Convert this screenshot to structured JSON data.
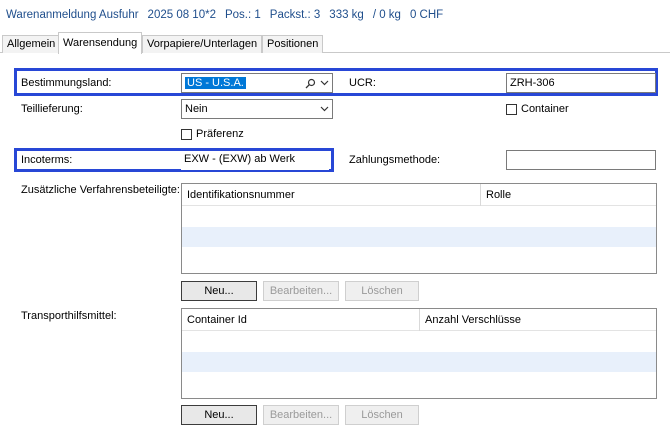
{
  "header": {
    "title": "Warenanmeldung Ausfuhr",
    "number": "2025 08 10*2",
    "pos": "Pos.: 1",
    "packst": "Packst.: 3",
    "weight": "333 kg",
    "weight2": "/ 0 kg",
    "value": "0 CHF"
  },
  "tabs": [
    {
      "label": "Allgemein"
    },
    {
      "label": "Warensendung"
    },
    {
      "label": "Vorpapiere/Unterlagen"
    },
    {
      "label": "Positionen"
    }
  ],
  "form": {
    "bestimmungsland_label": "Bestimmungsland:",
    "bestimmungsland_value": "US - U.S.A.",
    "ucr_label": "UCR:",
    "ucr_value": "ZRH-306",
    "teillieferung_label": "Teillieferung:",
    "teillieferung_value": "Nein",
    "container_label": "Container",
    "praeferenz_label": "Präferenz",
    "incoterms_label": "Incoterms:",
    "incoterms_value": "EXW - (EXW) ab Werk",
    "zahlungsmethode_label": "Zahlungsmethode:",
    "zahlungsmethode_value": ""
  },
  "beteiligte": {
    "label": "Zusätzliche Verfahrensbeteiligte:",
    "columns": [
      "Identifikationsnummer",
      "Rolle"
    ],
    "buttons": {
      "new": "Neu...",
      "edit": "Bearbeiten...",
      "delete": "Löschen"
    }
  },
  "transport": {
    "label": "Transporthilfsmittel:",
    "columns": [
      "Container Id",
      "Anzahl Verschlüsse"
    ],
    "buttons": {
      "new": "Neu...",
      "edit": "Bearbeiten...",
      "delete": "Löschen"
    }
  },
  "colors": {
    "highlight_border": "#2847d6",
    "header_text": "#1f4e8c",
    "selection": "#0078d7"
  }
}
